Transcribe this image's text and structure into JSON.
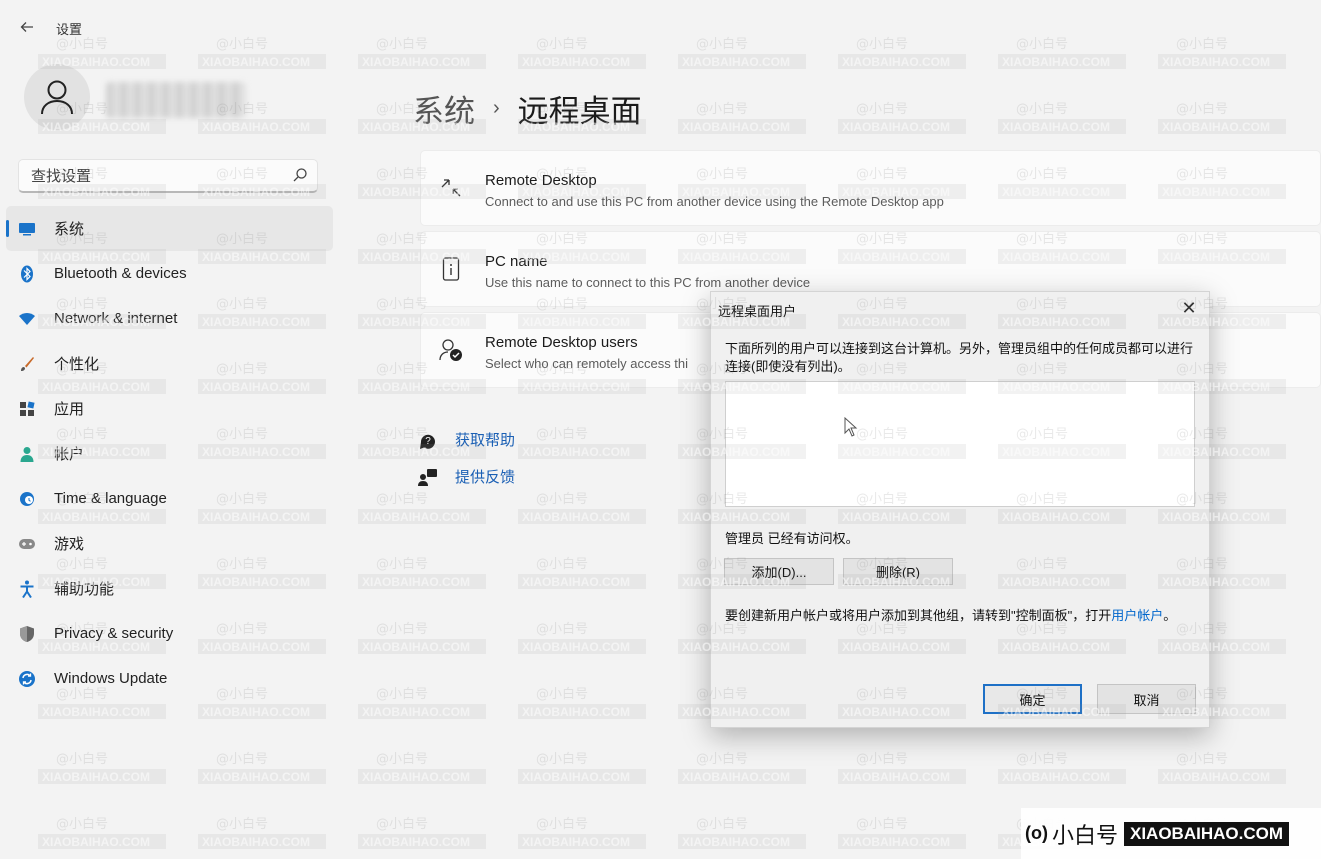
{
  "window": {
    "title": "设置",
    "back_icon": "back-arrow-icon"
  },
  "sidebar": {
    "profile": {
      "icon": "user-icon"
    },
    "search": {
      "placeholder": "查找设置",
      "icon": "search-icon"
    },
    "items": [
      {
        "label": "系统",
        "icon": "system-icon",
        "color": "#1a73c9",
        "active": true
      },
      {
        "label": "Bluetooth & devices",
        "icon": "bluetooth-icon",
        "color": "#1a73c9"
      },
      {
        "label": "Network & internet",
        "icon": "wifi-icon",
        "color": "#1a73c9"
      },
      {
        "label": "个性化",
        "icon": "brush-icon",
        "color": "#c86a2a"
      },
      {
        "label": "应用",
        "icon": "apps-icon",
        "color": "#555555"
      },
      {
        "label": "帐户",
        "icon": "account-icon",
        "color": "#2aa78f"
      },
      {
        "label": "Time & language",
        "icon": "globe-clock-icon",
        "color": "#1a73c9"
      },
      {
        "label": "游戏",
        "icon": "gamepad-icon",
        "color": "#777777"
      },
      {
        "label": "辅助功能",
        "icon": "accessibility-icon",
        "color": "#1a73c9"
      },
      {
        "label": "Privacy & security",
        "icon": "shield-icon",
        "color": "#666666"
      },
      {
        "label": "Windows Update",
        "icon": "update-icon",
        "color": "#1a73c9"
      }
    ]
  },
  "main": {
    "breadcrumb": {
      "parent": "系统",
      "separator": "›",
      "current": "远程桌面"
    },
    "cards": [
      {
        "title": "Remote Desktop",
        "subtitle": "Connect to and use this PC from another device using the Remote Desktop app",
        "icon": "remote-desktop-icon"
      },
      {
        "title": "PC name",
        "subtitle": "Use this name to connect to this PC from another device",
        "icon": "pc-info-icon"
      },
      {
        "title": "Remote Desktop users",
        "subtitle": "Select who can remotely access thi",
        "icon": "users-check-icon"
      }
    ],
    "links": [
      {
        "label": "获取帮助",
        "icon": "help-icon"
      },
      {
        "label": "提供反馈",
        "icon": "feedback-icon"
      }
    ]
  },
  "dialog": {
    "title": "远程桌面用户",
    "close_label": "✕",
    "description": "下面所列的用户可以连接到这台计算机。另外，管理员组中的任何成员都可以进行连接(即使没有列出)。",
    "admin_note": "管理员 已经有访问权。",
    "add_button": "添加(D)...",
    "remove_button": "删除(R)",
    "note_prefix": "要创建新用户帐户或将用户添加到其他组，请转到\"控制面板\"，打开",
    "note_link": "用户帐户",
    "note_suffix": "。",
    "ok_button": "确定",
    "cancel_button": "取消"
  },
  "watermark": {
    "signature": "(o)",
    "brand_cn": "小白号",
    "brand_en": "XIAOBAIHAO.COM",
    "tile_cn": "@小白号",
    "tile_en": "XIAOBAIHAO.COM"
  }
}
